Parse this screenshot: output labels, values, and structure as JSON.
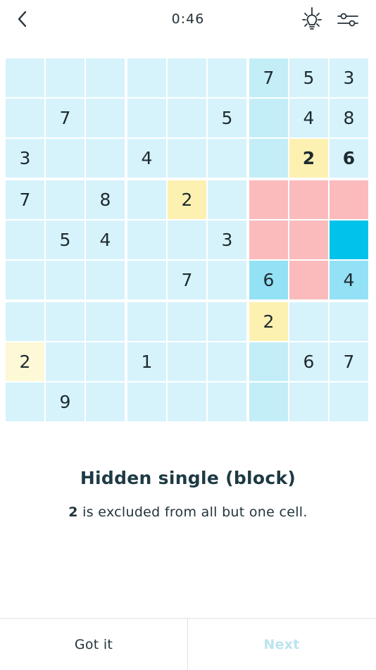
{
  "header": {
    "timer": "0:46",
    "back_icon": "chevron-left-icon",
    "hint_icon": "lightbulb-icon",
    "settings_icon": "sliders-icon"
  },
  "colors": {
    "cell_default": "#d6f3fb",
    "cell_house": "#c3eef8",
    "cell_yellow": "#fcf1b0",
    "cell_pale_yellow": "#fdf8d6",
    "cell_red": "#fbbbbd",
    "cell_target": "#01c2ea",
    "cell_marked": "#93e1f5"
  },
  "board": {
    "grid": [
      [
        "",
        "",
        "",
        "",
        "",
        "",
        "7",
        "5",
        "3"
      ],
      [
        "",
        "7",
        "",
        "",
        "",
        "5",
        "",
        "4",
        "8"
      ],
      [
        "3",
        "",
        "",
        "4",
        "",
        "",
        "",
        "2",
        "6"
      ],
      [
        "7",
        "",
        "8",
        "",
        "2",
        "",
        "",
        "",
        ""
      ],
      [
        "",
        "5",
        "4",
        "",
        "",
        "3",
        "",
        "",
        ""
      ],
      [
        "",
        "",
        "",
        "",
        "7",
        "",
        "6",
        "",
        "4"
      ],
      [
        "",
        "",
        "",
        "",
        "",
        "",
        "2",
        "",
        ""
      ],
      [
        "2",
        "",
        "",
        "1",
        "",
        "",
        "",
        "6",
        "7"
      ],
      [
        "",
        "9",
        "",
        "",
        "",
        "",
        "",
        "",
        ""
      ]
    ],
    "bold_cells": [
      [
        2,
        7
      ],
      [
        2,
        8
      ]
    ],
    "highlights": {
      "house": [
        [
          0,
          6
        ],
        [
          1,
          6
        ],
        [
          2,
          6
        ],
        [
          3,
          6
        ],
        [
          4,
          6
        ],
        [
          5,
          6
        ],
        [
          6,
          6
        ],
        [
          7,
          6
        ],
        [
          8,
          6
        ]
      ],
      "yellow": [
        [
          2,
          7
        ],
        [
          3,
          4
        ],
        [
          6,
          6
        ]
      ],
      "pale_yellow": [
        [
          7,
          0
        ]
      ],
      "red": [
        [
          3,
          6
        ],
        [
          3,
          7
        ],
        [
          3,
          8
        ],
        [
          4,
          6
        ],
        [
          4,
          7
        ],
        [
          5,
          7
        ]
      ],
      "target": [
        [
          4,
          8
        ]
      ],
      "marked": [
        [
          5,
          6
        ],
        [
          5,
          8
        ]
      ]
    }
  },
  "message": {
    "title": "Hidden single (block)",
    "digit": "2",
    "text": "is excluded from all but one cell."
  },
  "footer": {
    "got_it": "Got it",
    "next": "Next"
  }
}
